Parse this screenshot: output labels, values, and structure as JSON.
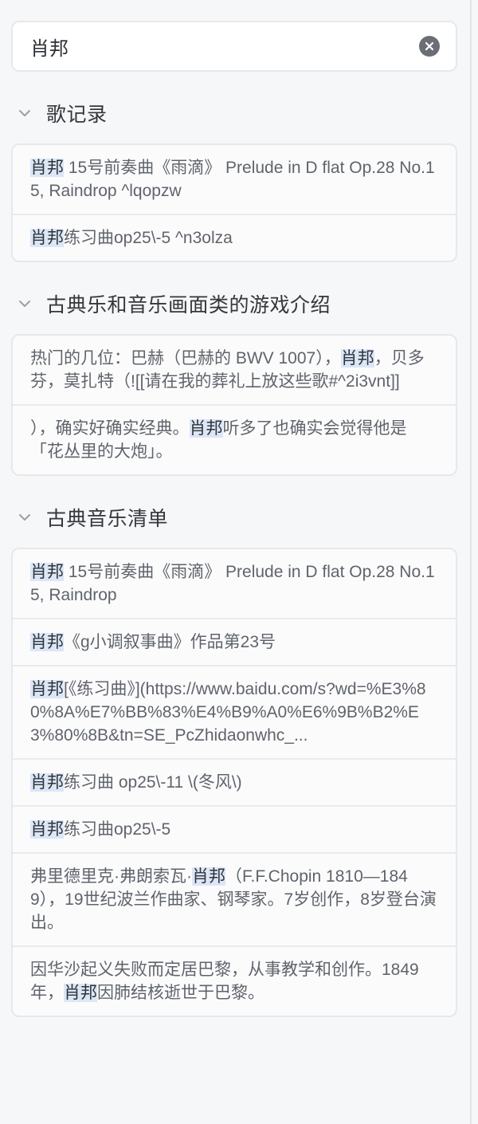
{
  "search": {
    "value": "肖邦",
    "highlight": "肖邦"
  },
  "sections": [
    {
      "title": "歌记录",
      "items": [
        {
          "parts": [
            {
              "t": "肖邦",
              "hl": true
            },
            {
              "t": " 15号前奏曲《雨滴》 Prelude in D flat Op.28 No.15, Raindrop ^lqopzw"
            }
          ]
        },
        {
          "parts": [
            {
              "t": "肖邦",
              "hl": true
            },
            {
              "t": "练习曲op25\\-5 ^n3olza"
            }
          ]
        }
      ]
    },
    {
      "title": "古典乐和音乐画面类的游戏介绍",
      "items": [
        {
          "parts": [
            {
              "t": "热门的几位：巴赫（巴赫的 BWV 1007），"
            },
            {
              "t": "肖邦",
              "hl": true
            },
            {
              "t": "，贝多芬，莫扎特（![[请在我的葬礼上放这些歌#^2i3vnt]]"
            }
          ]
        },
        {
          "parts": [
            {
              "t": "），确实好确实经典。"
            },
            {
              "t": "肖邦",
              "hl": true
            },
            {
              "t": "听多了也确实会觉得他是「花丛里的大炮」。"
            }
          ]
        }
      ]
    },
    {
      "title": "古典音乐清单",
      "items": [
        {
          "parts": [
            {
              "t": "肖邦",
              "hl": true
            },
            {
              "t": " 15号前奏曲《雨滴》 Prelude in D flat Op.28 No.15, Raindrop"
            }
          ]
        },
        {
          "parts": [
            {
              "t": "肖邦",
              "hl": true
            },
            {
              "t": "《g小调叙事曲》作品第23号"
            }
          ]
        },
        {
          "parts": [
            {
              "t": "肖邦",
              "hl": true
            },
            {
              "t": "[《练习曲》](https://www.baidu.com/s?wd=%E3%80%8A%E7%BB%83%E4%B9%A0%E6%9B%B2%E3%80%8B&tn=SE_PcZhidaonwhc_..."
            }
          ]
        },
        {
          "parts": [
            {
              "t": "肖邦",
              "hl": true
            },
            {
              "t": "练习曲 op25\\-11 \\(冬风\\)"
            }
          ]
        },
        {
          "parts": [
            {
              "t": "肖邦",
              "hl": true
            },
            {
              "t": "练习曲op25\\-5"
            }
          ]
        },
        {
          "parts": [
            {
              "t": "弗里德里克·弗朗索瓦·"
            },
            {
              "t": "肖邦",
              "hl": true
            },
            {
              "t": "（F.F.Chopin 1810—1849），19世纪波兰作曲家、钢琴家。7岁创作，8岁登台演出。"
            }
          ]
        },
        {
          "parts": [
            {
              "t": "因华沙起义失败而定居巴黎，从事教学和创作。1849年，"
            },
            {
              "t": "肖邦",
              "hl": true
            },
            {
              "t": "因肺结核逝世于巴黎。"
            }
          ]
        }
      ]
    }
  ],
  "icons": {
    "clear": "close-circle-icon",
    "collapse": "chevron-down-icon"
  },
  "colors": {
    "highlight_bg": "#dbe6f7",
    "card_bg": "#fbfbfc",
    "border": "#e6e8eb"
  }
}
